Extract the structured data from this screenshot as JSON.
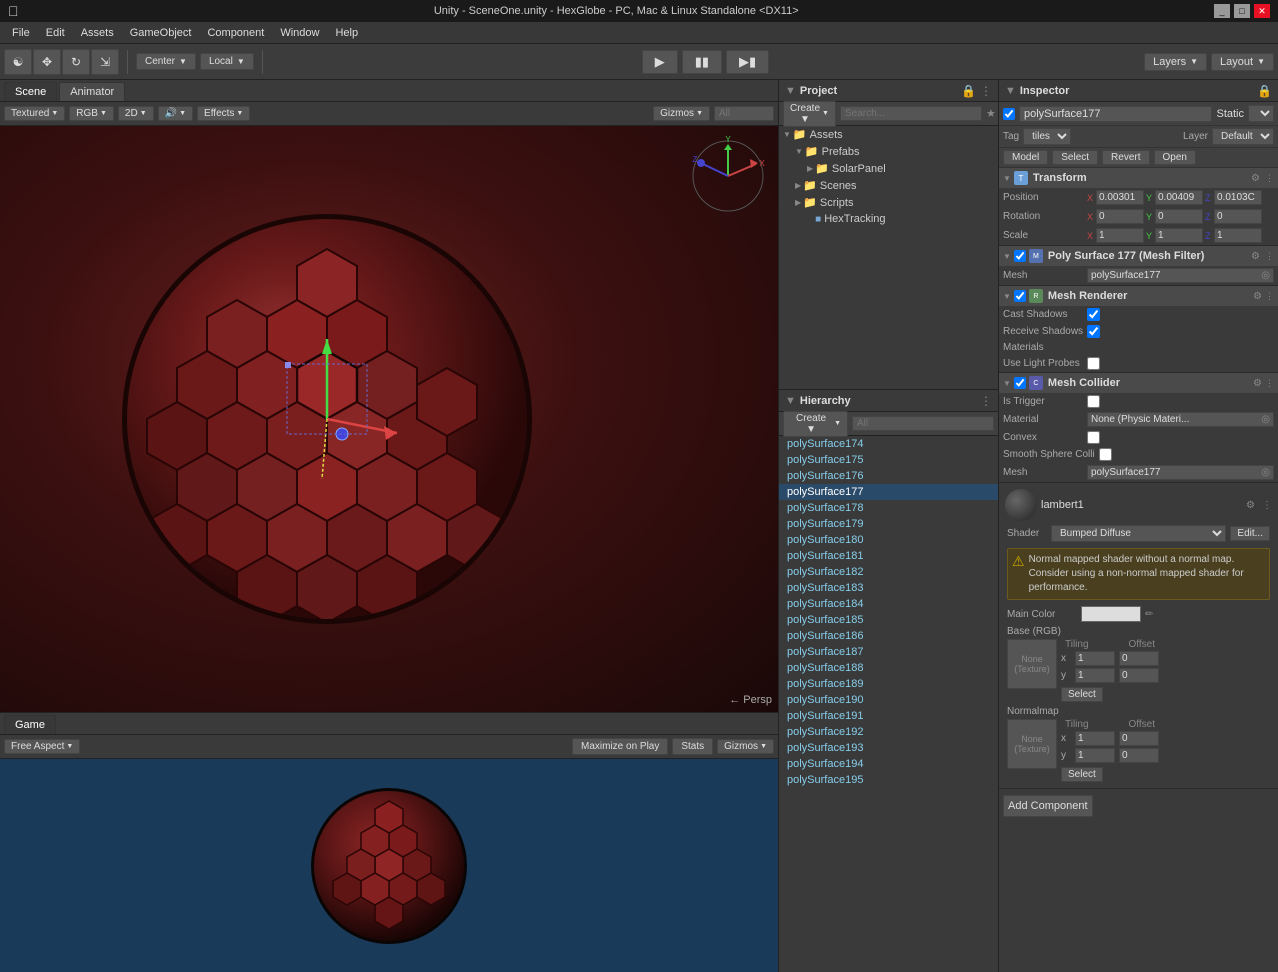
{
  "window": {
    "title": "Unity - SceneOne.unity - HexGlobe - PC, Mac & Linux Standalone <DX11>"
  },
  "menubar": {
    "items": [
      "File",
      "Edit",
      "Assets",
      "GameObject",
      "Component",
      "Window",
      "Help"
    ]
  },
  "toolbar": {
    "tools": [
      "hand",
      "move",
      "rotate",
      "scale"
    ],
    "pivot_labels": [
      "Center",
      "Local"
    ],
    "layers_label": "Layers",
    "layout_label": "Layout"
  },
  "scene": {
    "tab_label": "Scene",
    "animator_tab_label": "Animator",
    "shading": "Textured",
    "color": "RGB",
    "mode_2d": "2D",
    "effects_label": "Effects",
    "gizmos_label": "Gizmos",
    "search_placeholder": "All",
    "persp_label": "← Persp"
  },
  "game": {
    "tab_label": "Game",
    "aspect_label": "Free Aspect",
    "maximize_label": "Maximize on Play",
    "stats_label": "Stats",
    "gizmos_label": "Gizmos"
  },
  "project": {
    "header_label": "Project",
    "create_label": "Create ▼",
    "tree": [
      {
        "label": "Assets",
        "type": "folder",
        "indent": 0,
        "arrow": "▼"
      },
      {
        "label": "Prefabs",
        "type": "folder",
        "indent": 1,
        "arrow": "▼"
      },
      {
        "label": "SolarPanel",
        "type": "folder",
        "indent": 2,
        "arrow": "▶"
      },
      {
        "label": "Scenes",
        "type": "folder",
        "indent": 1,
        "arrow": "▶"
      },
      {
        "label": "Scripts",
        "type": "folder",
        "indent": 1,
        "arrow": "▶"
      },
      {
        "label": "HexTracking",
        "type": "file",
        "indent": 2,
        "arrow": ""
      }
    ]
  },
  "hierarchy": {
    "header_label": "Hierarchy",
    "create_label": "Create ▼",
    "search_placeholder": "All",
    "items": [
      "polySurface174",
      "polySurface175",
      "polySurface176",
      "polySurface177",
      "polySurface178",
      "polySurface179",
      "polySurface180",
      "polySurface181",
      "polySurface182",
      "polySurface183",
      "polySurface184",
      "polySurface185",
      "polySurface186",
      "polySurface187",
      "polySurface188",
      "polySurface189",
      "polySurface190",
      "polySurface191",
      "polySurface192",
      "polySurface193",
      "polySurface194",
      "polySurface195"
    ],
    "selected": "polySurface177"
  },
  "inspector": {
    "header_label": "Inspector",
    "obj_name": "polySurface177",
    "static_label": "Static",
    "tag_label": "Tag",
    "tag_value": "tiles",
    "layer_label": "Layer",
    "layer_value": "Default",
    "model_btn": "Model",
    "select_btn": "Select",
    "revert_btn": "Revert",
    "open_btn": "Open",
    "transform": {
      "title": "Transform",
      "position_label": "Position",
      "pos_x": "0.00301",
      "pos_y": "0.00409",
      "pos_z": "0.0103C",
      "rotation_label": "Rotation",
      "rot_x": "0",
      "rot_y": "0",
      "rot_z": "0",
      "scale_label": "Scale",
      "scale_x": "1",
      "scale_y": "1",
      "scale_z": "1"
    },
    "mesh_filter": {
      "title": "Poly Surface 177 (Mesh Filter)",
      "mesh_label": "Mesh",
      "mesh_value": "polySurface177"
    },
    "mesh_renderer": {
      "title": "Mesh Renderer",
      "cast_shadows_label": "Cast Shadows",
      "receive_shadows_label": "Receive Shadows",
      "materials_label": "Materials",
      "use_light_probes_label": "Use Light Probes"
    },
    "mesh_collider": {
      "title": "Mesh Collider",
      "is_trigger_label": "Is Trigger",
      "material_label": "Material",
      "material_value": "None (Physic Materi...",
      "convex_label": "Convex",
      "smooth_sphere_label": "Smooth Sphere Colli",
      "mesh_label": "Mesh",
      "mesh_value": "polySurface177"
    },
    "material": {
      "name": "lambert1",
      "shader_label": "Shader",
      "shader_value": "Bumped Diffuse",
      "edit_label": "Edit...",
      "warning_text": "Normal mapped shader without a normal map. Consider using a non-normal mapped shader for performance.",
      "main_color_label": "Main Color",
      "base_rgb_label": "Base (RGB)",
      "tiling_label": "Tiling",
      "offset_label": "Offset",
      "tile_x": "1",
      "tile_y": "1",
      "offset_x": "0",
      "offset_y": "0",
      "normalmap_label": "Normalmap",
      "norm_tile_x": "1",
      "norm_tile_y": "1",
      "norm_offset_x": "0",
      "norm_offset_y": "0",
      "none_texture1": "None\n(Texture)",
      "none_texture2": "None\n(Texture)",
      "select_label": "Select"
    },
    "add_component_label": "Add Component"
  }
}
